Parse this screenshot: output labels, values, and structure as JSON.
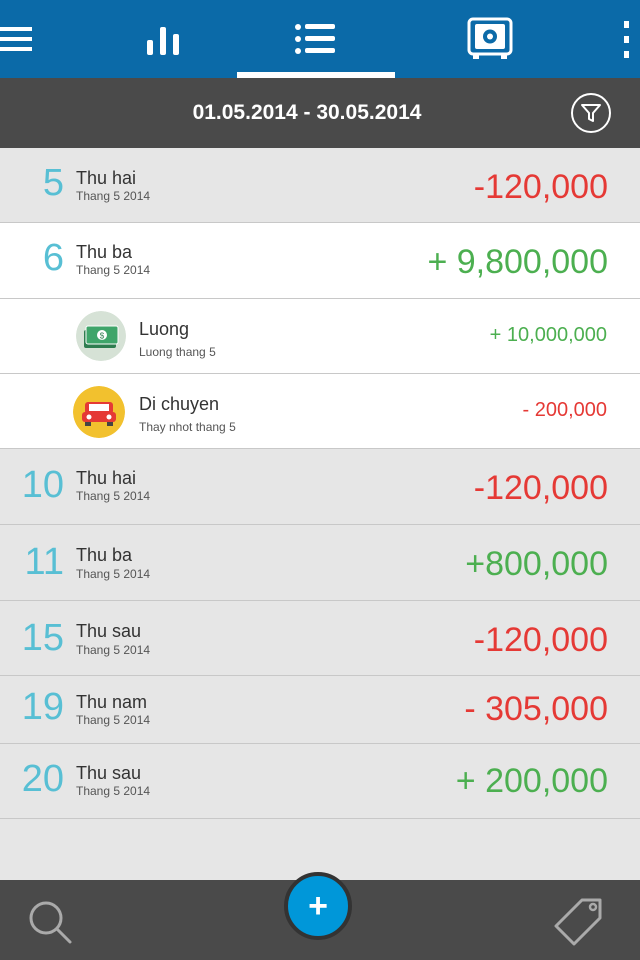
{
  "header": {
    "icons": [
      "menu-icon",
      "bar-chart-icon",
      "list-icon",
      "safe-icon",
      "more-vertical-icon"
    ]
  },
  "date_range": "01.05.2014 - 30.05.2014",
  "days": [
    {
      "day": "5",
      "weekday": "Thu hai",
      "month": "Thang 5 2014",
      "amount": "-120,000",
      "sign": "neg"
    },
    {
      "day": "6",
      "weekday": "Thu ba",
      "month": "Thang 5 2014",
      "amount": "+ 9,800,000",
      "sign": "pos",
      "transactions": [
        {
          "title": "Luong",
          "note": "Luong thang 5",
          "amount": "+ 10,000,000",
          "sign": "pos",
          "icon": "cash-icon"
        },
        {
          "title": "Di chuyen",
          "note": "Thay nhot thang 5",
          "amount": "- 200,000",
          "sign": "neg",
          "icon": "car-icon"
        }
      ]
    },
    {
      "day": "10",
      "weekday": "Thu hai",
      "month": "Thang 5 2014",
      "amount": "-120,000",
      "sign": "neg"
    },
    {
      "day": "11",
      "weekday": "Thu ba",
      "month": "Thang 5 2014",
      "amount": "+800,000",
      "sign": "pos"
    },
    {
      "day": "15",
      "weekday": "Thu sau",
      "month": "Thang 5 2014",
      "amount": "-120,000",
      "sign": "neg"
    },
    {
      "day": "19",
      "weekday": "Thu nam",
      "month": "Thang 5 2014",
      "amount": "- 305,000",
      "sign": "neg"
    },
    {
      "day": "20",
      "weekday": "Thu sau",
      "month": "Thang 5 2014",
      "amount": "+ 200,000",
      "sign": "pos"
    }
  ],
  "footer": {
    "add_label": "+",
    "icons": [
      "search-icon",
      "add-icon",
      "tag-icon"
    ]
  },
  "colors": {
    "header_bg": "#0b6aa8",
    "bar_bg": "#4a4a4a",
    "day_number": "#58bfd4",
    "positive": "#4caf50",
    "negative": "#e53935",
    "add_button": "#0097d9"
  }
}
